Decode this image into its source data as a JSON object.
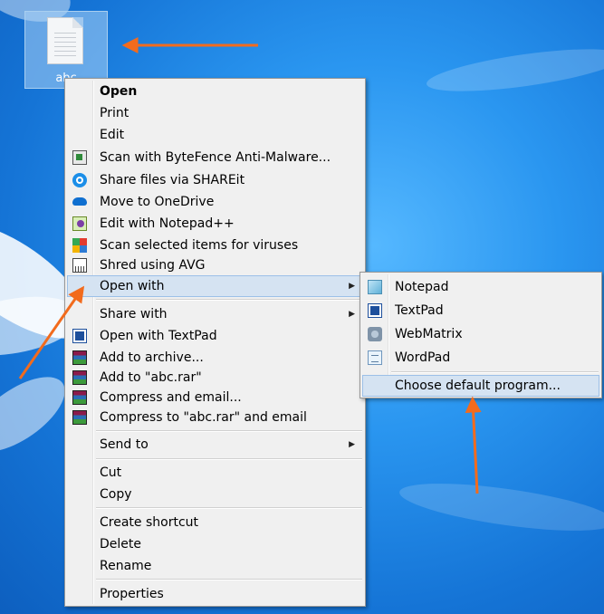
{
  "desktop": {
    "icon_label": "abc"
  },
  "context_menu": {
    "items": [
      {
        "label": "Open",
        "icon": "",
        "bold": true
      },
      {
        "label": "Print",
        "icon": ""
      },
      {
        "label": "Edit",
        "icon": ""
      },
      {
        "label": "Scan with ByteFence Anti-Malware...",
        "icon": "bytefence-icon"
      },
      {
        "label": "Share files via SHAREit",
        "icon": "shareit-icon"
      },
      {
        "label": "Move to OneDrive",
        "icon": "onedrive-icon"
      },
      {
        "label": "Edit with Notepad++",
        "icon": "notepadpp-icon"
      },
      {
        "label": "Scan selected items for viruses",
        "icon": "avg-icon"
      },
      {
        "label": "Shred using AVG",
        "icon": "shredder-icon"
      },
      {
        "label": "Open with",
        "icon": "",
        "submenu": true,
        "highlighted": true
      },
      {
        "label": "Share with",
        "icon": "",
        "submenu": true
      },
      {
        "label": "Open with TextPad",
        "icon": "textpad-icon"
      },
      {
        "label": "Add to archive...",
        "icon": "winrar-icon"
      },
      {
        "label": "Add to \"abc.rar\"",
        "icon": "winrar-icon"
      },
      {
        "label": "Compress and email...",
        "icon": "winrar-icon"
      },
      {
        "label": "Compress to \"abc.rar\" and email",
        "icon": "winrar-icon"
      },
      {
        "label": "Send to",
        "icon": "",
        "submenu": true
      },
      {
        "label": "Cut",
        "icon": ""
      },
      {
        "label": "Copy",
        "icon": ""
      },
      {
        "label": "Create shortcut",
        "icon": ""
      },
      {
        "label": "Delete",
        "icon": ""
      },
      {
        "label": "Rename",
        "icon": ""
      },
      {
        "label": "Properties",
        "icon": ""
      }
    ],
    "submenu_arrow": "▶"
  },
  "open_with_submenu": {
    "items": [
      {
        "label": "Notepad",
        "icon": "notepad-icon"
      },
      {
        "label": "TextPad",
        "icon": "textpad-icon"
      },
      {
        "label": "WebMatrix",
        "icon": "webmatrix-icon"
      },
      {
        "label": "WordPad",
        "icon": "wordpad-icon"
      },
      {
        "label": "Choose default program...",
        "icon": "",
        "highlighted": true
      }
    ]
  },
  "annotations": {
    "arrow_color": "#f26b1d"
  }
}
